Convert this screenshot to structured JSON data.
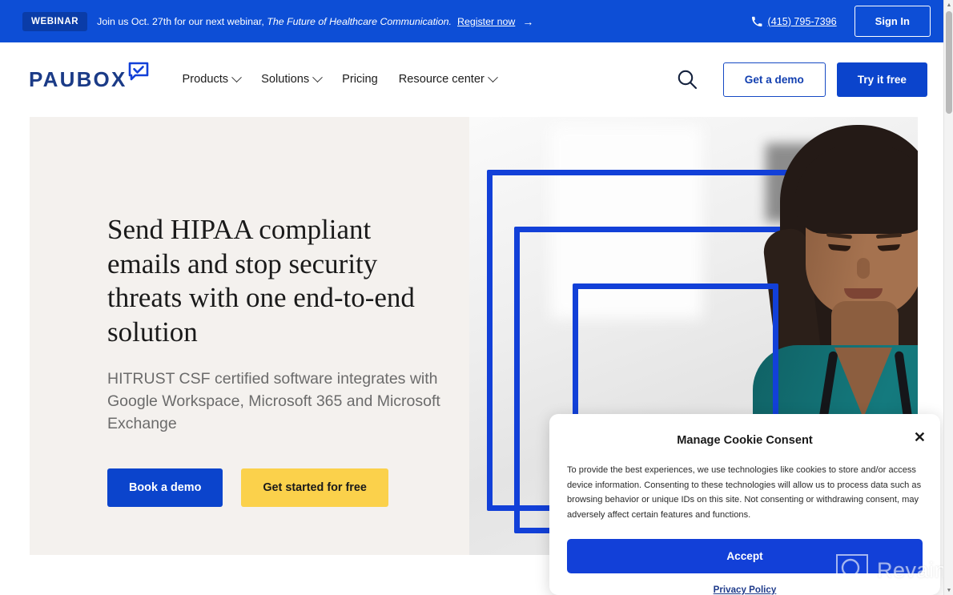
{
  "banner": {
    "badge": "WEBINAR",
    "text_before": "Join us Oct. 27th for our next webinar,",
    "text_italic": "The Future of Healthcare Communication.",
    "register_label": "Register now",
    "arrow": "→",
    "phone": "(415) 795-7396",
    "phone_icon": "phone-icon",
    "signin_label": "Sign In",
    "bg_color": "#0d4ed6",
    "badge_bg_color": "#0a3ca8"
  },
  "nav": {
    "logo_text": "PAUBOX",
    "logo_icon": "speech-bubble-check-icon",
    "logo_color": "#1b3b87",
    "items": [
      {
        "label": "Products",
        "has_chevron": true
      },
      {
        "label": "Solutions",
        "has_chevron": true
      },
      {
        "label": "Pricing",
        "has_chevron": false
      },
      {
        "label": "Resource center",
        "has_chevron": true
      }
    ],
    "search_icon": "search-icon",
    "demo_label": "Get a demo",
    "tryfree_label": "Try it free",
    "accent_color": "#0b44cc"
  },
  "hero": {
    "title": "Send HIPAA compliant emails and stop security threats with one end-to-end solution",
    "subtitle": "HITRUST CSF certified software integrates with Google Workspace, Microsoft 365 and Microsoft Exchange",
    "cta_primary": "Book a demo",
    "cta_secondary": "Get started for free",
    "bg_color": "#f4f1ee",
    "primary_color": "#0b44cc",
    "secondary_color": "#fbd14b",
    "image_alt": "healthcare-worker-photo"
  },
  "cookie_consent": {
    "title": "Manage Cookie Consent",
    "close_icon": "close-icon",
    "body": "To provide the best experiences, we use technologies like cookies to store and/or access device information. Consenting to these technologies will allow us to process data such as browsing behavior or unique IDs on this site. Not consenting or withdrawing consent, may adversely affect certain features and functions.",
    "accept_label": "Accept",
    "privacy_label": "Privacy Policy",
    "accept_color": "#1240d8"
  },
  "watermark": {
    "text": "Revain",
    "icon": "revain-magnifier-logo-icon"
  },
  "scrollbar": {
    "up_arrow": "▲",
    "down_arrow": "▼"
  }
}
